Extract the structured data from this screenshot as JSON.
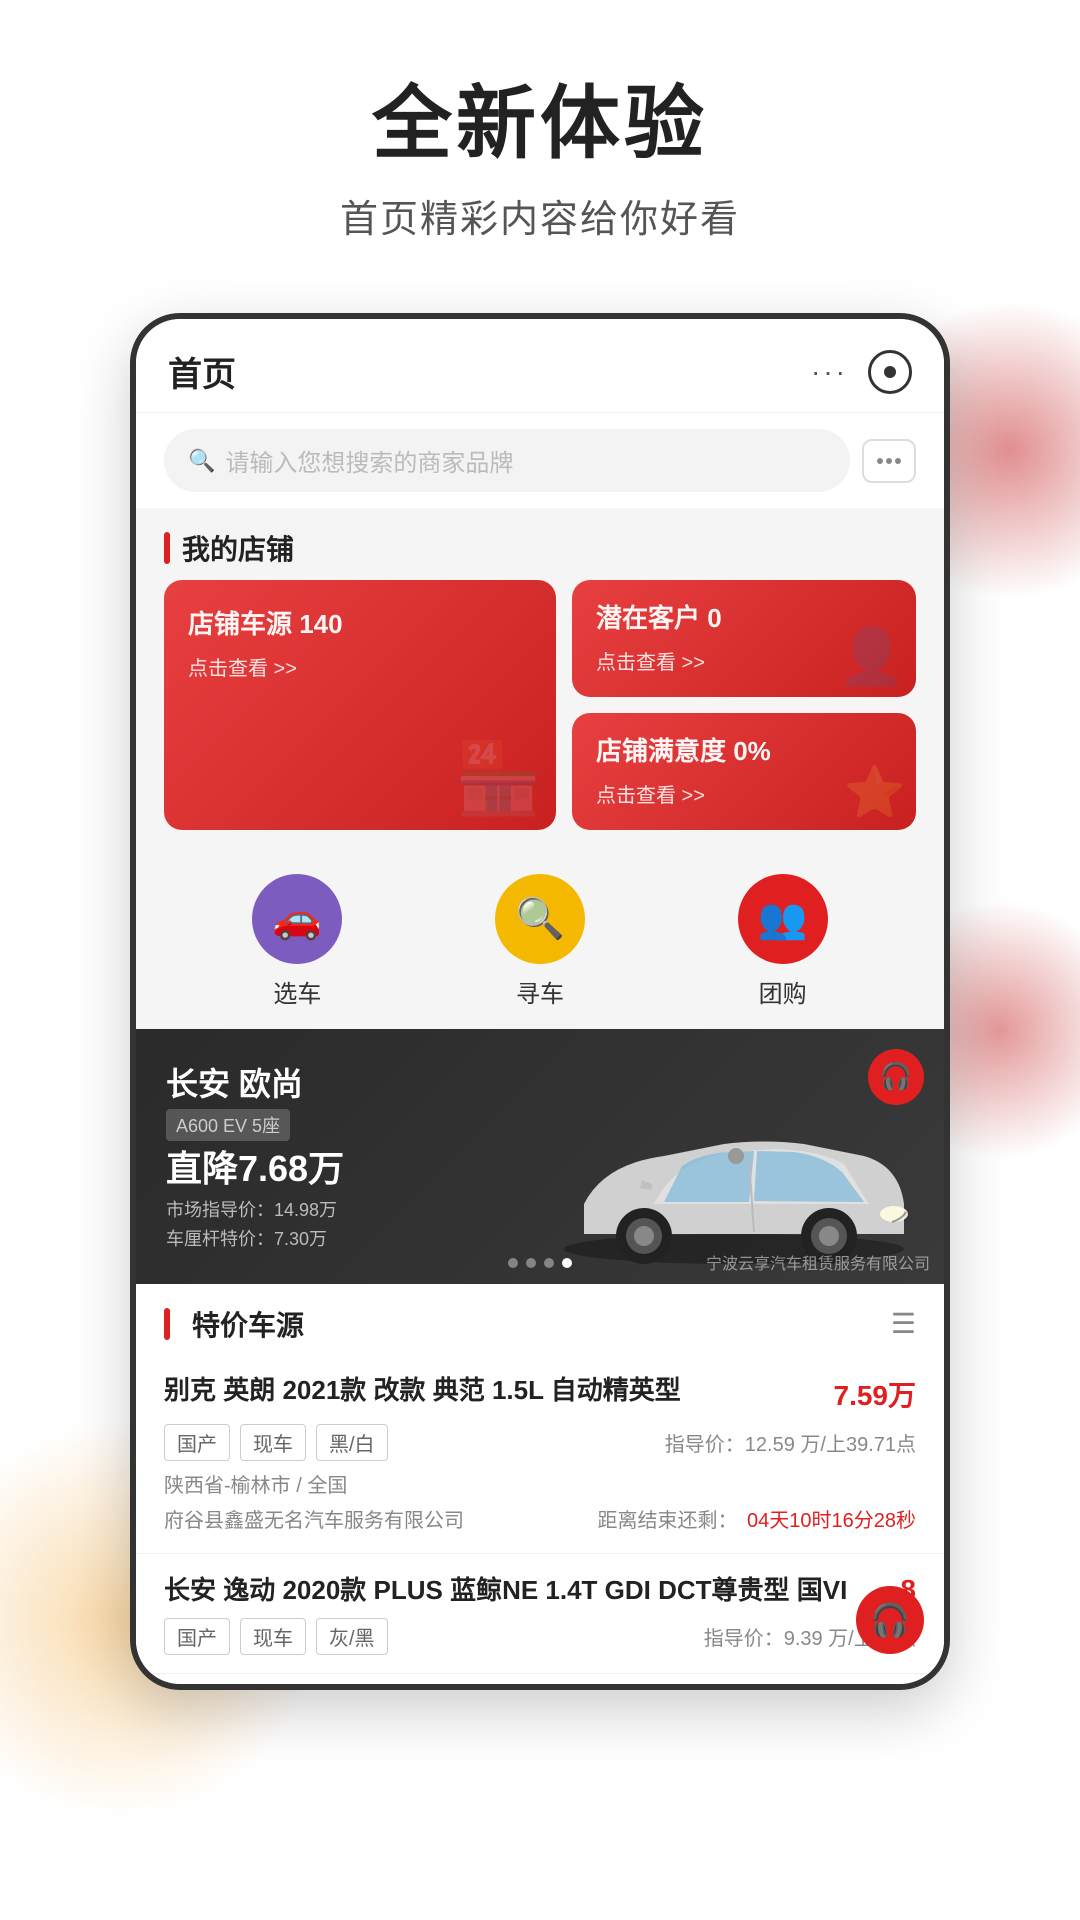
{
  "header": {
    "title": "全新体验",
    "subtitle": "首页精彩内容给你好看"
  },
  "phone": {
    "topbar": {
      "title": "首页",
      "dots_label": "···",
      "more_icon": "more-icon",
      "camera_icon": "camera-icon"
    },
    "search": {
      "placeholder": "请输入您想搜索的商家品牌",
      "chat_icon": "chat-icon"
    },
    "my_shop": {
      "section_title": "我的店铺",
      "card1": {
        "label": "店铺车源 140",
        "action": "点击查看 >>"
      },
      "card2": {
        "label": "潜在客户 0",
        "action": "点击查看 >>"
      },
      "card3": {
        "label": "店铺满意度 0%",
        "action": "点击查看 >>"
      }
    },
    "quick_actions": [
      {
        "id": "select-car",
        "icon": "🚗",
        "label": "选车",
        "color": "qa-purple"
      },
      {
        "id": "find-car",
        "icon": "🔍",
        "label": "寻车",
        "color": "qa-yellow"
      },
      {
        "id": "group-buy",
        "icon": "👥",
        "label": "团购",
        "color": "qa-red"
      }
    ],
    "car_banner": {
      "brand": "长安 欧尚",
      "model_tag": "A600 EV 5座",
      "discount": "直降7.68万",
      "price_market": "市场指导价：14.98万",
      "price_special": "车厘杆特价：7.30万",
      "company": "宁波云享汽车租赁服务有限公司",
      "dots": [
        "dot1",
        "dot2",
        "dot3",
        "dot4"
      ]
    },
    "tejia": {
      "section_title": "特价车源",
      "cars": [
        {
          "name": "别克 英朗 2021款 改款 典范 1.5L 自动精英型",
          "price": "7.59万",
          "tags": [
            "国产",
            "现车",
            "黑/白"
          ],
          "guide_price": "指导价：12.59 万/上39.71点",
          "location": "陕西省-榆林市 / 全国",
          "dealer": "府谷县鑫盛无名汽车服务有限公司",
          "countdown_label": "距离结束还剩：",
          "countdown": "04天10时16分28秒"
        },
        {
          "name": "长安 逸动 2020款 PLUS 蓝鲸NE 1.4T GDI DCT尊贵型 国VI",
          "price": "8",
          "tags": [
            "国产",
            "现车",
            "灰/黑"
          ],
          "guide_price": "指导价：9.39 万/上10点"
        }
      ]
    }
  }
}
